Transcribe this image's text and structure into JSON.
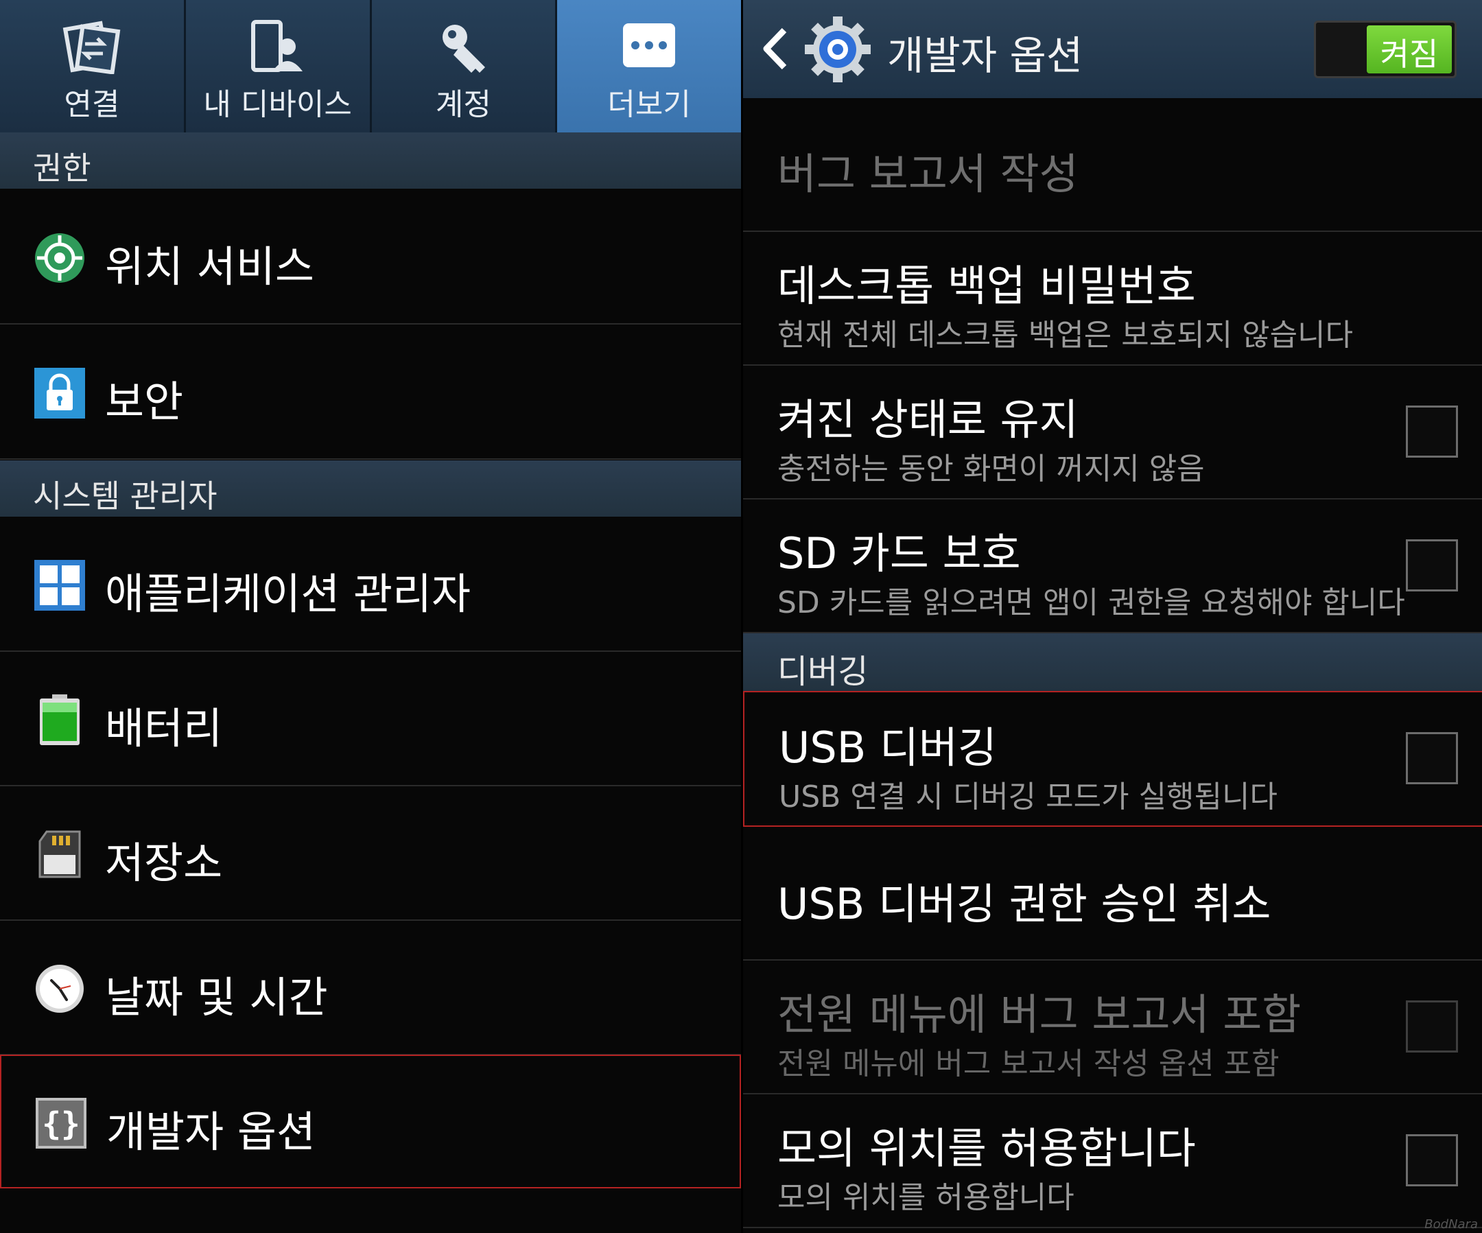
{
  "left": {
    "tabs": [
      {
        "label": "연결",
        "icon": "connection-icon",
        "active": false
      },
      {
        "label": "내 디바이스",
        "icon": "my-device-icon",
        "active": false
      },
      {
        "label": "계정",
        "icon": "key-icon",
        "active": false
      },
      {
        "label": "더보기",
        "icon": "more-icon",
        "active": true
      }
    ],
    "sections": [
      {
        "title": "권한"
      },
      {
        "title": "시스템 관리자"
      }
    ],
    "items": [
      {
        "label": "위치 서비스",
        "icon": "location-icon"
      },
      {
        "label": "보안",
        "icon": "lock-icon"
      },
      {
        "label": "애플리케이션 관리자",
        "icon": "apps-grid-icon"
      },
      {
        "label": "배터리",
        "icon": "battery-icon"
      },
      {
        "label": "저장소",
        "icon": "sd-card-icon"
      },
      {
        "label": "날짜 및 시간",
        "icon": "clock-icon"
      },
      {
        "label": "개발자 옵션",
        "icon": "braces-icon",
        "selected": true
      }
    ]
  },
  "right": {
    "actionbar": {
      "title": "개발자 옵션",
      "toggle_label": "켜짐",
      "toggle_on": true
    },
    "items": [
      {
        "title": "버그 보고서 작성",
        "disabled": true
      },
      {
        "title": "데스크톱 백업 비밀번호",
        "subtitle": "현재 전체 데스크톱 백업은 보호되지 않습니다"
      },
      {
        "title": "켜진 상태로 유지",
        "subtitle": "충전하는 동안 화면이 꺼지지 않음",
        "checked": false
      },
      {
        "title": "SD 카드 보호",
        "subtitle": "SD 카드를 읽으려면 앱이 권한을 요청해야 합니다",
        "checked": false
      }
    ],
    "section_debugging": "디버깅",
    "debug_items": [
      {
        "title": "USB 디버깅",
        "subtitle": "USB 연결 시 디버깅 모드가 실행됩니다",
        "checked": false,
        "selected": true
      },
      {
        "title": "USB 디버깅 권한 승인 취소"
      },
      {
        "title": "전원 메뉴에 버그 보고서 포함",
        "subtitle": "전원 메뉴에 버그 보고서 작성 옵션 포함",
        "checked": false,
        "disabled": true
      },
      {
        "title": "모의 위치를 허용합니다",
        "subtitle": "모의 위치를 허용합니다",
        "checked": false
      }
    ]
  },
  "watermark": "BodNara",
  "colors": {
    "tab_active": "#4a86c3",
    "section_bg": "#2b3d50",
    "toggle_on": "#6cc931",
    "selection_border": "#b42222"
  }
}
